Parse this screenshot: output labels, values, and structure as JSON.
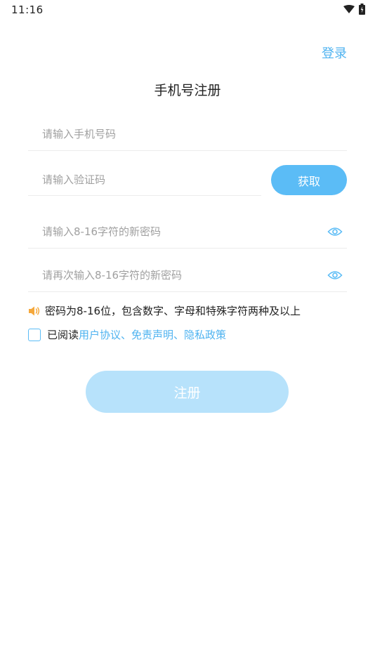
{
  "status_bar": {
    "time": "11:16",
    "icons": [
      "wifi-icon",
      "battery-icon"
    ]
  },
  "header": {
    "login_label": "登录",
    "title": "手机号注册"
  },
  "form": {
    "phone": {
      "placeholder": "请输入手机号码",
      "value": ""
    },
    "code": {
      "placeholder": "请输入验证码",
      "value": ""
    },
    "get_code_label": "获取",
    "password": {
      "placeholder": "请输入8-16字符的新密码",
      "value": "",
      "icon": "eye-icon"
    },
    "password_confirm": {
      "placeholder": "请再次输入8-16字符的新密码",
      "value": "",
      "icon": "eye-icon"
    }
  },
  "hint": {
    "icon": "speaker-icon",
    "text": "密码为8-16位，包含数字、字母和特殊字符两种及以上"
  },
  "agreement": {
    "checked": false,
    "prefix": "已阅读",
    "links_text": "用户协议、免责声明、隐私政策"
  },
  "register_label": "注册",
  "colors": {
    "accent": "#5bbcf6",
    "link": "#4fb3f0",
    "button_disabled": "#b7e2fb",
    "hint_icon": "#f5a83c"
  }
}
